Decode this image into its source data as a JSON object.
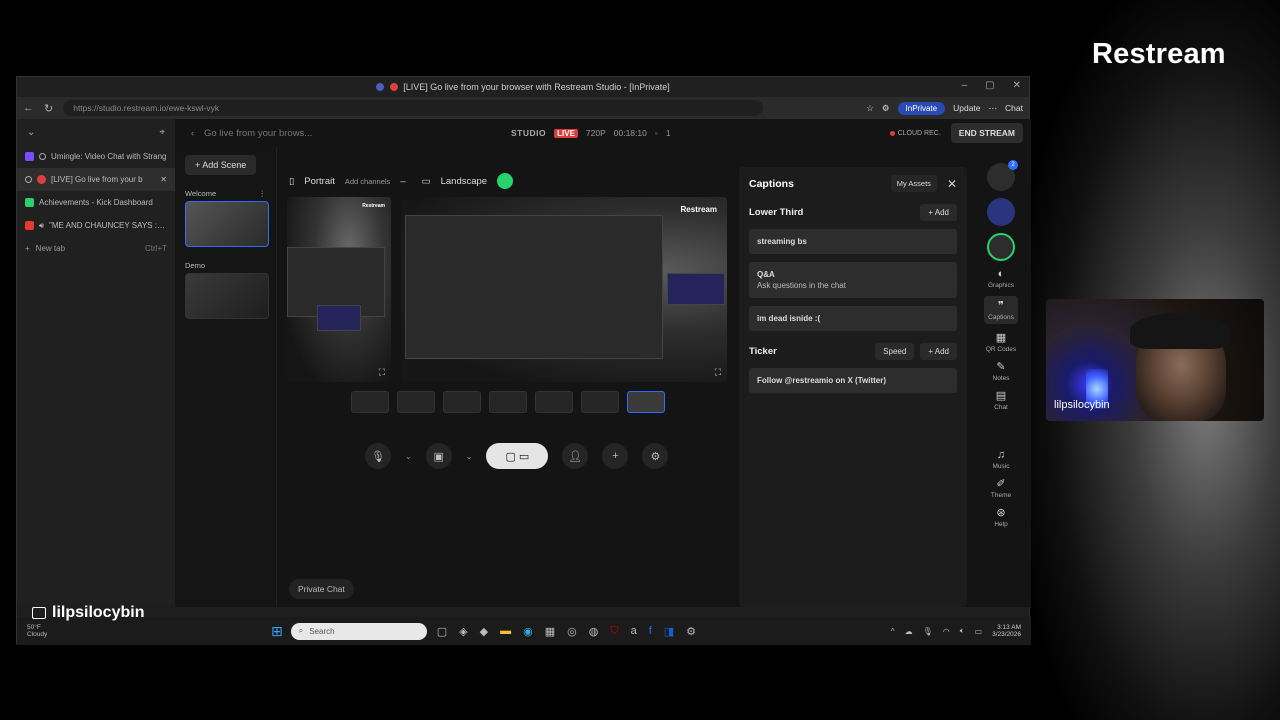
{
  "overlay": {
    "brand": "Restream",
    "streamer_name": "lilpsilocybin",
    "webcam_name": "lilpsilocybin"
  },
  "browser": {
    "window_title": "[LIVE] Go live from your browser with Restream Studio - [InPrivate]",
    "url": "https://studio.restream.io/ewe-kswl-vyk",
    "inprivate": "InPrivate",
    "update": "Update",
    "chat": "Chat",
    "tabs": [
      {
        "label": "Umingle: Video Chat with Strang",
        "color": "#7b4cff"
      },
      {
        "label": "[LIVE] Go live from your b",
        "color": "#d8413f"
      },
      {
        "label": "Achievements - Kick Dashboard",
        "color": "#27d36a"
      },
      {
        "label": "\"ME AND CHAUNCEY SAYS : FU",
        "color": "#e53a2f"
      }
    ],
    "new_tab": "New tab",
    "new_tab_shortcut": "Ctrl+T"
  },
  "studio": {
    "page_title": "Go live from your brows...",
    "brand": "STUDIO",
    "live": "LIVE",
    "resolution": "720P",
    "timer": "00:18:10",
    "viewers": "1",
    "cloud_rec": "CLOUD REC.",
    "end_stream": "END STREAM",
    "add_scene": "+ Add Scene",
    "scenes": [
      "Welcome",
      "Demo"
    ],
    "portrait": "Portrait",
    "add_channels": "Add channels",
    "landscape": "Landscape",
    "preview_logo": "Restream",
    "private_chat": "Private Chat"
  },
  "captions": {
    "title": "Captions",
    "my_assets": "My Assets",
    "lower_third": "Lower Third",
    "add": "+ Add",
    "items": [
      {
        "title": "streaming bs",
        "sub": ""
      },
      {
        "title": "Q&A",
        "sub": "Ask questions in the chat"
      },
      {
        "title": "im dead isnide :(",
        "sub": ""
      }
    ],
    "ticker": "Ticker",
    "speed": "Speed",
    "ticker_text": "Follow @restreamio on X (Twitter)"
  },
  "rail": {
    "badge": "2",
    "items": [
      "Graphics",
      "Captions",
      "QR Codes",
      "Notes",
      "Chat",
      "Music",
      "Theme",
      "Help"
    ]
  },
  "taskbar": {
    "temp": "50°F",
    "weather": "Cloudy",
    "search": "Search",
    "time": "3:13 AM",
    "date": "3/23/2026"
  }
}
